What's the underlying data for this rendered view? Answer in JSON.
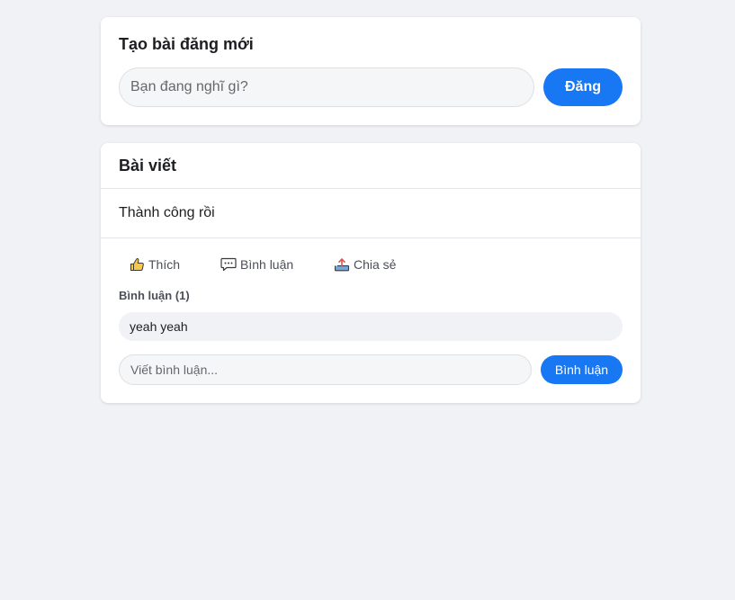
{
  "compose": {
    "title": "Tạo bài đăng mới",
    "placeholder": "Bạn đang nghĩ gì?",
    "value": "",
    "post_label": "Đăng"
  },
  "post": {
    "header": "Bài viết",
    "content": "Thành công rồi",
    "actions": {
      "like_label": "Thích",
      "comment_label": "Bình luận",
      "share_label": "Chia sẻ",
      "like_icon": "thumbs-up-icon",
      "comment_icon": "speech-bubble-icon",
      "share_icon": "share-tray-icon"
    },
    "comments_heading": "Bình luận (1)",
    "comments": [
      {
        "text": "yeah yeah"
      }
    ],
    "comment_input_placeholder": "Viết bình luận...",
    "comment_submit_label": "Bình luận"
  },
  "colors": {
    "background": "#f0f2f5",
    "accent": "#1877f2",
    "card": "#ffffff"
  }
}
